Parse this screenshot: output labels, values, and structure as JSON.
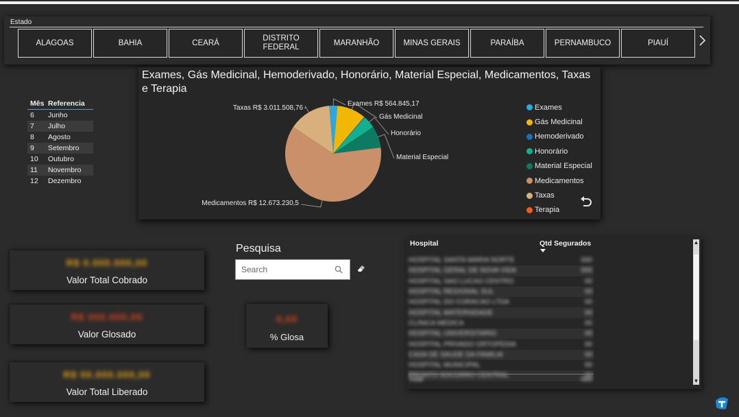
{
  "estado": {
    "title": "Estado",
    "items": [
      "ALAGOAS",
      "BAHIA",
      "CEARÁ",
      "DISTRITO FEDERAL",
      "MARANHÃO",
      "MINAS GERAIS",
      "PARAÍBA",
      "PERNAMBUCO",
      "PIAUÍ"
    ],
    "next_icon": "chevron-right-icon"
  },
  "mes_table": {
    "headers": [
      "Mês",
      "Referencia"
    ],
    "rows": [
      [
        "6",
        "Junho"
      ],
      [
        "7",
        "Julho"
      ],
      [
        "8",
        "Agosto"
      ],
      [
        "9",
        "Setembro"
      ],
      [
        "10",
        "Outubro"
      ],
      [
        "11",
        "Novembro"
      ],
      [
        "12",
        "Dezembro"
      ]
    ]
  },
  "chart_data": {
    "type": "pie",
    "title": "Exames, Gás Medicinal, Hemoderivado, Honorário, Material Especial, Medicamentos, Taxas e Terapia",
    "slices": [
      {
        "name": "Exames",
        "value": 564845.17,
        "color": "#2aa8e0",
        "label": "Exames R$ 564.845,17"
      },
      {
        "name": "Gás Medicinal",
        "value": 2050000,
        "color": "#f2b705",
        "label": "Gás Medicinal"
      },
      {
        "name": "Hemoderivado",
        "value": 60000,
        "color": "#1c6fb5",
        "label": ""
      },
      {
        "name": "Honorário",
        "value": 880000,
        "color": "#13b08f",
        "label": "Honorário"
      },
      {
        "name": "Material Especial",
        "value": 1530000,
        "color": "#0d7a64",
        "label": "Material Especial"
      },
      {
        "name": "Medicamentos",
        "value": 12873230.5,
        "color": "#c9906a",
        "label": "Medicamentos R$ 12.673.230,5"
      },
      {
        "name": "Taxas",
        "value": 3011508.76,
        "color": "#d7b07e",
        "label": "Taxas R$ 3.011.508,76"
      },
      {
        "name": "Terapia",
        "value": 5000,
        "color": "#ee5a24",
        "label": ""
      }
    ],
    "legend_position": "right"
  },
  "cards": {
    "cobrado": {
      "value": "R$ 0.000.000,00",
      "label": "Valor Total Cobrado",
      "value_color": "#e8a317"
    },
    "glosado": {
      "value": "R$ 000.000,00",
      "label": "Valor Glosado",
      "value_color": "#e0441f"
    },
    "liberado": {
      "value": "R$ 00.000.000,00",
      "label": "Valor Total Liberado",
      "value_color": "#e8a317"
    },
    "glosa": {
      "value": "0,00",
      "label": "% Glosa",
      "value_color": "#e0441f"
    }
  },
  "pesquisa": {
    "title": "Pesquisa",
    "placeholder": "Search",
    "search_icon": "search-icon",
    "clear_icon": "eraser-icon"
  },
  "hospital_table": {
    "headers": [
      "Hospital",
      "Qtd Segurados"
    ],
    "rows": [
      [
        "HOSPITAL SANTA MARIA NORTE",
        "000"
      ],
      [
        "HOSPITAL GERAL DE NOVA VIDA",
        "000"
      ],
      [
        "HOSPITAL SAO LUCAS CENTRO",
        "00"
      ],
      [
        "HOSPITAL REGIONAL SUL",
        "00"
      ],
      [
        "HOSPITAL DO CORACAO LTDA",
        "00"
      ],
      [
        "HOSPITAL MATERNIDADE",
        "00"
      ],
      [
        "CLINICA MEDICA",
        "00"
      ],
      [
        "HOSPITAL UNIVERSITARIO",
        "00"
      ],
      [
        "HOSPITAL PRIVADO ORTOPEDIA",
        "00"
      ],
      [
        "CASA DE SAUDE DA FAMILIA",
        "00"
      ],
      [
        "HOSPITAL MUNICIPAL",
        "00"
      ],
      [
        "PRONTO SOCORRO CENTRAL",
        "00"
      ]
    ],
    "total": [
      "Total",
      "000"
    ]
  }
}
